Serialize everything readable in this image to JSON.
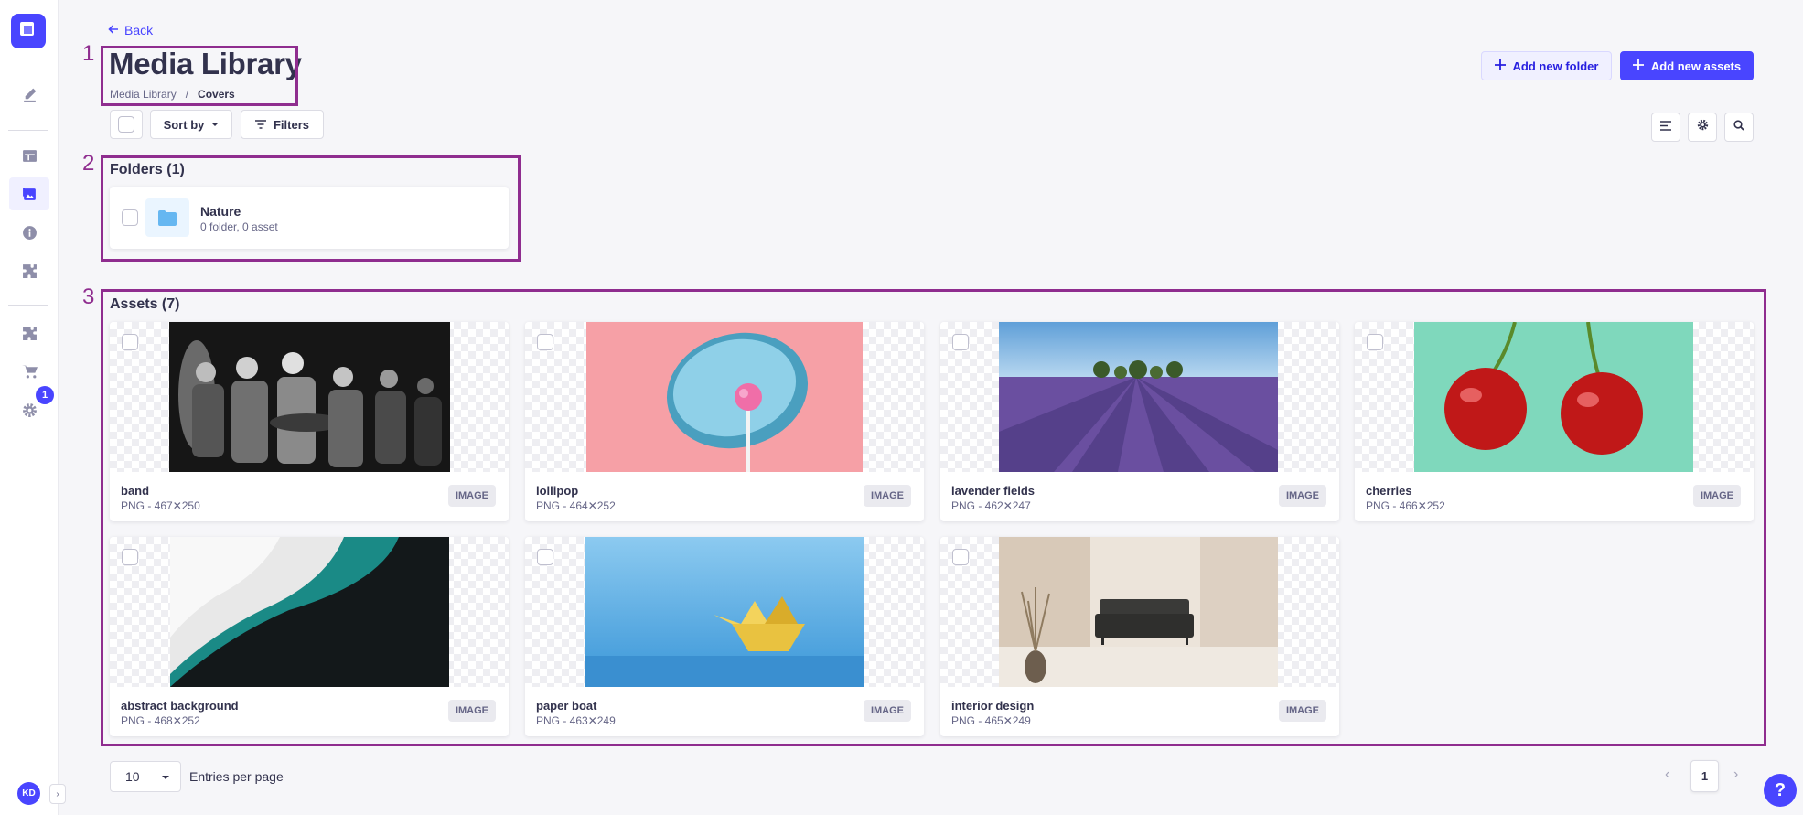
{
  "nav": {
    "items": [
      {
        "icon": "pencil-icon"
      },
      {
        "icon": "content-type-builder-icon"
      },
      {
        "icon": "media-library-icon"
      },
      {
        "icon": "info-icon"
      },
      {
        "icon": "plugin-icon"
      },
      {
        "icon": "marketplace-icon"
      },
      {
        "icon": "cart-icon"
      },
      {
        "icon": "settings-icon"
      }
    ],
    "settings_badge": "1",
    "avatar_initials": "KD"
  },
  "header": {
    "back_label": "Back",
    "title": "Media Library",
    "breadcrumb": {
      "root": "Media Library",
      "separator": "/",
      "current": "Covers"
    },
    "add_folder_label": "Add new folder",
    "add_assets_label": "Add new assets"
  },
  "toolbar": {
    "sort_label": "Sort by",
    "filters_label": "Filters"
  },
  "annotations": [
    "1",
    "2",
    "3"
  ],
  "folders": {
    "title": "Folders (1)",
    "items": [
      {
        "name": "Nature",
        "meta": "0 folder, 0 asset"
      }
    ]
  },
  "assets": {
    "title": "Assets (7)",
    "items": [
      {
        "name": "band",
        "meta": "PNG - 467✕250",
        "type": "IMAGE"
      },
      {
        "name": "lollipop",
        "meta": "PNG - 464✕252",
        "type": "IMAGE"
      },
      {
        "name": "lavender fields",
        "meta": "PNG - 462✕247",
        "type": "IMAGE"
      },
      {
        "name": "cherries",
        "meta": "PNG - 466✕252",
        "type": "IMAGE"
      },
      {
        "name": "abstract background",
        "meta": "PNG - 468✕252",
        "type": "IMAGE"
      },
      {
        "name": "paper boat",
        "meta": "PNG - 463✕249",
        "type": "IMAGE"
      },
      {
        "name": "interior design",
        "meta": "PNG - 465✕249",
        "type": "IMAGE"
      }
    ]
  },
  "pagination": {
    "page_size": "10",
    "entries_label": "Entries per page",
    "current_page": "1"
  },
  "colors": {
    "accent": "#4945ff",
    "annotation": "#8f2d8f"
  }
}
